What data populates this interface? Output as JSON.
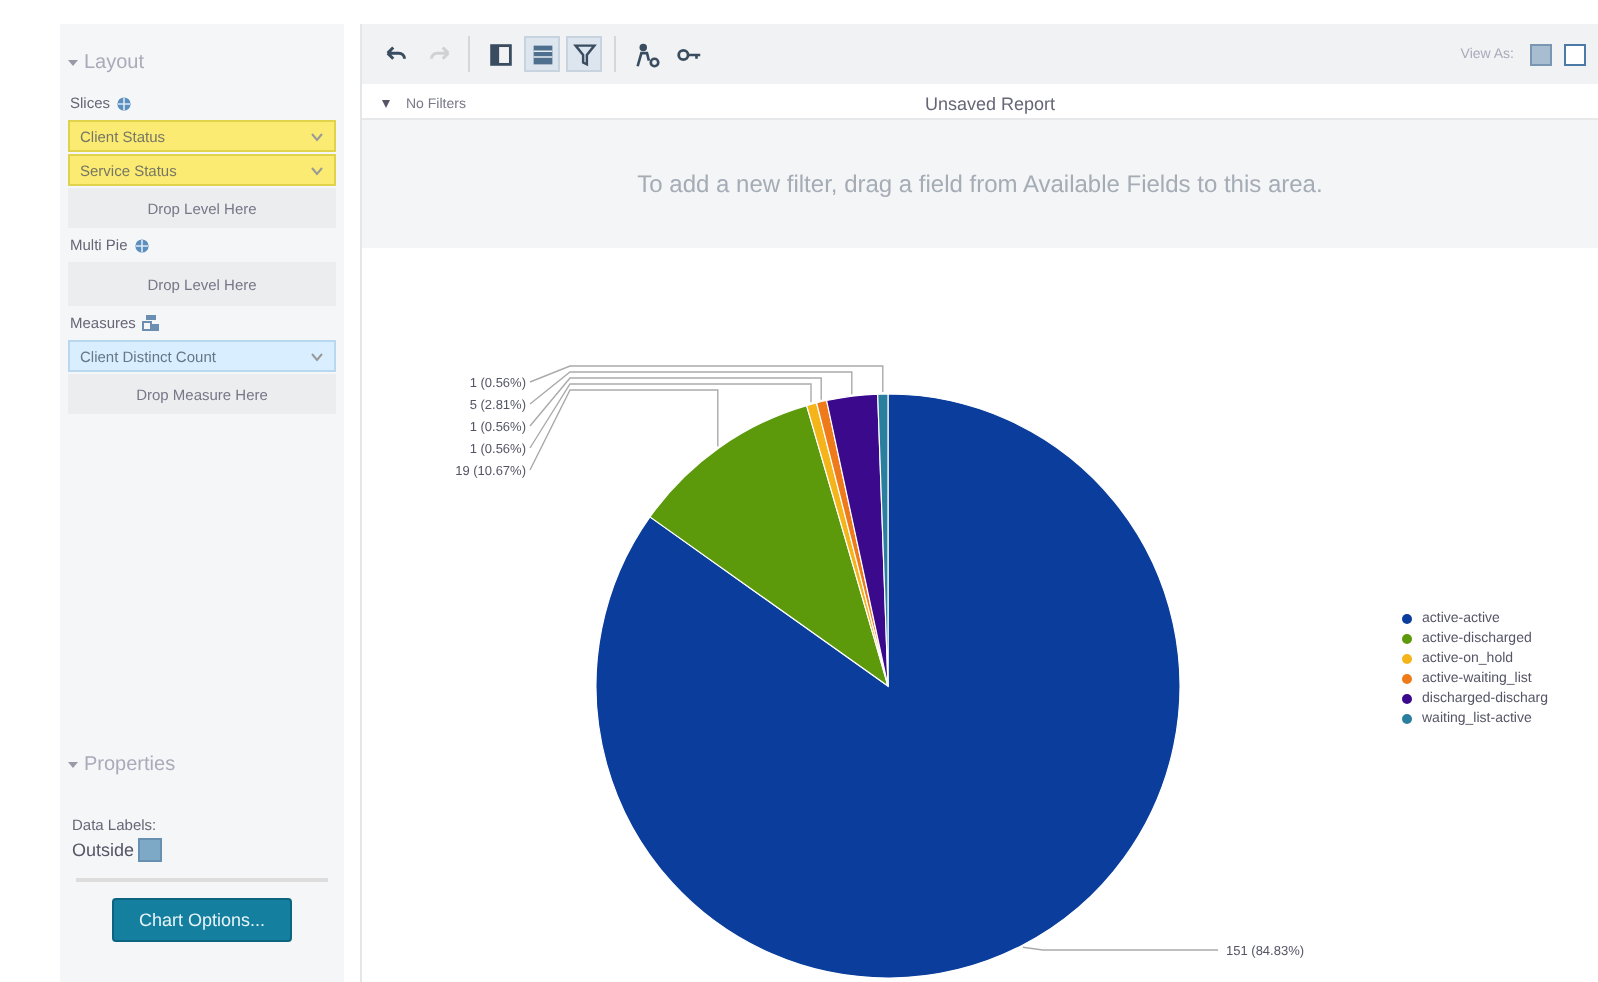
{
  "sidebar": {
    "layout_title": "Layout",
    "slices_label": "Slices",
    "slices": [
      {
        "label": "Client Status"
      },
      {
        "label": "Service Status"
      }
    ],
    "slices_drop": "Drop Level Here",
    "multi_pie_label": "Multi Pie",
    "multi_pie_drop": "Drop Level Here",
    "measures_label": "Measures",
    "measures": [
      {
        "label": "Client Distinct Count"
      }
    ],
    "measures_drop": "Drop Measure Here",
    "properties_title": "Properties",
    "data_labels_label": "Data Labels:",
    "data_labels_value": "Outside",
    "chart_options_button": "Chart Options..."
  },
  "toolbar": {
    "buttons": [
      {
        "kind": "undo",
        "selected": false,
        "disabled": false
      },
      {
        "kind": "redo",
        "selected": false,
        "disabled": true
      },
      {
        "kind": "layout",
        "selected": false,
        "disabled": false
      },
      {
        "kind": "table",
        "selected": true,
        "disabled": false
      },
      {
        "kind": "filter",
        "selected": true,
        "disabled": false
      },
      {
        "kind": "person",
        "selected": false,
        "disabled": false
      },
      {
        "kind": "key",
        "selected": false,
        "disabled": false
      }
    ],
    "view_as_label": "View As:"
  },
  "filters": {
    "toggle_label": "No Filters",
    "report_title": "Unsaved Report",
    "drop_hint": "To add a new filter, drag a field from Available Fields to this area."
  },
  "chart_data": {
    "type": "pie",
    "categories": [
      "active-active",
      "active-discharged",
      "active-on_hold",
      "active-waiting_list",
      "discharged-discharg",
      "waiting_list-active"
    ],
    "values": [
      151,
      19,
      1,
      1,
      5,
      1
    ],
    "colors": [
      "#0a3d9c",
      "#5c9a0c",
      "#f5b419",
      "#ef7a1a",
      "#3b0a8c",
      "#2a7f9e"
    ],
    "value_labels": [
      "151 (84.83%)",
      "19 (10.67%)",
      "1 (0.56%)",
      "1 (0.56%)",
      "5 (2.81%)",
      "1 (0.56%)"
    ],
    "legend": true
  }
}
